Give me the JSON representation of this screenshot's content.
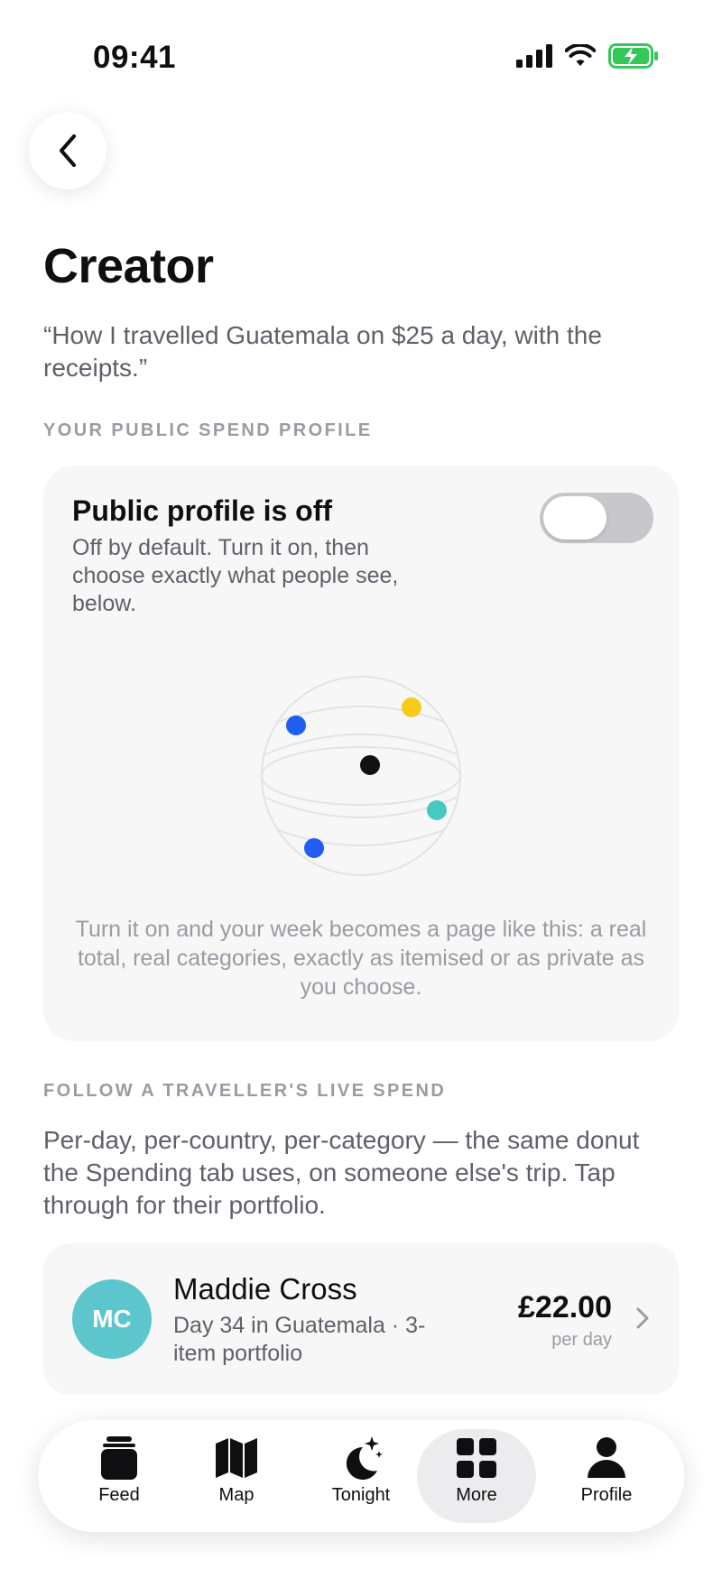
{
  "status_bar": {
    "time": "09:41"
  },
  "header": {
    "title": "Creator",
    "subtitle": "“How I travelled Guatemala on $25 a day, with the receipts.”"
  },
  "public_profile": {
    "section_label": "YOUR PUBLIC SPEND PROFILE",
    "title": "Public profile is off",
    "description": "Off by default. Turn it on, then choose exactly what people see, below.",
    "toggle_on": false,
    "caption": "Turn it on and your week becomes a page like this: a real total, real categories, exactly as itemised or as private as you choose.",
    "globe_dot_colors": [
      "#1f5ef0",
      "#f5cc1c",
      "#111111",
      "#45c9c0",
      "#1f5ef0"
    ]
  },
  "follow": {
    "section_label": "FOLLOW A TRAVELLER'S LIVE SPEND",
    "description": "Per-day, per-country, per-category — the same donut the Spending tab uses, on someone else's trip. Tap through for their portfolio.",
    "travellers": [
      {
        "initials": "MC",
        "name": "Maddie Cross",
        "meta": "Day 34 in Guatemala · 3-item portfolio",
        "amount": "£22.00",
        "unit": "per day",
        "avatar_color": "#5cc6cc"
      }
    ]
  },
  "tab_bar": {
    "tabs": [
      {
        "label": "Feed",
        "icon": "feed-icon"
      },
      {
        "label": "Map",
        "icon": "map-icon"
      },
      {
        "label": "Tonight",
        "icon": "moon-icon"
      },
      {
        "label": "More",
        "icon": "grid-icon",
        "active": true
      },
      {
        "label": "Profile",
        "icon": "person-icon"
      }
    ]
  },
  "colors": {
    "accent_teal": "#5cc6cc",
    "battery_green": "#34c759"
  }
}
